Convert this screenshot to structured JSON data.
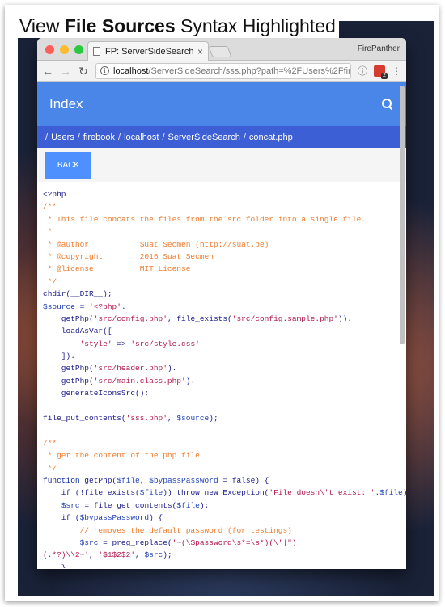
{
  "caption": {
    "prefix": "View ",
    "bold": "File Sources",
    "suffix": " Syntax Highlighted"
  },
  "browser": {
    "tab_title": "FP: ServerSideSearch",
    "tab_close": "×",
    "profile": "FirePanther",
    "url_host": "localhost",
    "url_rest": "/ServerSideSearch/sss.php?path=%2FUsers%2Ffirebo...",
    "ext_badge": "2"
  },
  "app": {
    "brand": "Index",
    "breadcrumb": [
      {
        "label": "Users",
        "link": true
      },
      {
        "label": "firebook",
        "link": true
      },
      {
        "label": "localhost",
        "link": true
      },
      {
        "label": "ServerSideSearch",
        "link": true
      },
      {
        "label": "concat.php",
        "link": false
      }
    ],
    "back_label": "BACK"
  },
  "colors": {
    "default": "#1a1a8a",
    "comment": "#f07a2a",
    "string": "#b0174a",
    "variable": "#1f3fb8",
    "func": "#0b2aa0"
  },
  "code_lines": [
    [
      [
        "default",
        "<?php"
      ]
    ],
    [
      [
        "comment",
        "/**"
      ]
    ],
    [
      [
        "comment",
        " * This file concats the files from the src folder into a single file."
      ]
    ],
    [
      [
        "comment",
        " *"
      ]
    ],
    [
      [
        "comment",
        " * @author           Suat Secmen (http://suat.be)"
      ]
    ],
    [
      [
        "comment",
        " * @copyright        2016 Suat Secmen"
      ]
    ],
    [
      [
        "comment",
        " * @license          MIT License"
      ]
    ],
    [
      [
        "comment",
        " */"
      ]
    ],
    [
      [
        "default",
        "chdir(__DIR__);"
      ]
    ],
    [
      [
        "variable",
        "$source"
      ],
      [
        "default",
        " = "
      ],
      [
        "string",
        "'<?php'"
      ],
      [
        "default",
        "."
      ]
    ],
    [
      [
        "default",
        "    getPhp("
      ],
      [
        "string",
        "'src/config.php'"
      ],
      [
        "default",
        ", file_exists("
      ],
      [
        "string",
        "'src/config.sample.php'"
      ],
      [
        "default",
        "))."
      ]
    ],
    [
      [
        "default",
        "    loadAsVar(["
      ]
    ],
    [
      [
        "default",
        "        "
      ],
      [
        "string",
        "'style'"
      ],
      [
        "default",
        " => "
      ],
      [
        "string",
        "'src/style.css'"
      ]
    ],
    [
      [
        "default",
        "    ])."
      ]
    ],
    [
      [
        "default",
        "    getPhp("
      ],
      [
        "string",
        "'src/header.php'"
      ],
      [
        "default",
        ")."
      ]
    ],
    [
      [
        "default",
        "    getPhp("
      ],
      [
        "string",
        "'src/main.class.php'"
      ],
      [
        "default",
        ")."
      ]
    ],
    [
      [
        "default",
        "    generateIconsSrc();"
      ]
    ],
    [
      [
        "default",
        ""
      ]
    ],
    [
      [
        "default",
        "file_put_contents("
      ],
      [
        "string",
        "'sss.php'"
      ],
      [
        "default",
        ", "
      ],
      [
        "variable",
        "$source"
      ],
      [
        "default",
        ");"
      ]
    ],
    [
      [
        "default",
        ""
      ]
    ],
    [
      [
        "comment",
        "/**"
      ]
    ],
    [
      [
        "comment",
        " * get the content of the php file"
      ]
    ],
    [
      [
        "comment",
        " */"
      ]
    ],
    [
      [
        "func",
        "function"
      ],
      [
        "default",
        " getPhp("
      ],
      [
        "variable",
        "$file"
      ],
      [
        "default",
        ", "
      ],
      [
        "variable",
        "$bypassPassword"
      ],
      [
        "default",
        " = false) {"
      ]
    ],
    [
      [
        "default",
        "    if (!file_exists("
      ],
      [
        "variable",
        "$file"
      ],
      [
        "default",
        ")) throw new Exception("
      ],
      [
        "string",
        "'File doesn\\'t exist: '"
      ],
      [
        "default",
        "."
      ],
      [
        "variable",
        "$file"
      ],
      [
        "default",
        ");"
      ]
    ],
    [
      [
        "default",
        "    "
      ],
      [
        "variable",
        "$src"
      ],
      [
        "default",
        " = file_get_contents("
      ],
      [
        "variable",
        "$file"
      ],
      [
        "default",
        ");"
      ]
    ],
    [
      [
        "default",
        "    if ("
      ],
      [
        "variable",
        "$bypassPassword"
      ],
      [
        "default",
        ") {"
      ]
    ],
    [
      [
        "comment",
        "        // removes the default password (for testings)"
      ]
    ],
    [
      [
        "default",
        "        "
      ],
      [
        "variable",
        "$src"
      ],
      [
        "default",
        " = preg_replace("
      ],
      [
        "string",
        "'~(\\$password\\s*=\\s*)(\\'|\")"
      ]
    ],
    [
      [
        "string",
        "(.*?)\\\\2~'"
      ],
      [
        "default",
        ", "
      ],
      [
        "string",
        "'$1$2$2'"
      ],
      [
        "default",
        ", "
      ],
      [
        "variable",
        "$src"
      ],
      [
        "default",
        ");"
      ]
    ],
    [
      [
        "default",
        "    }"
      ]
    ]
  ]
}
